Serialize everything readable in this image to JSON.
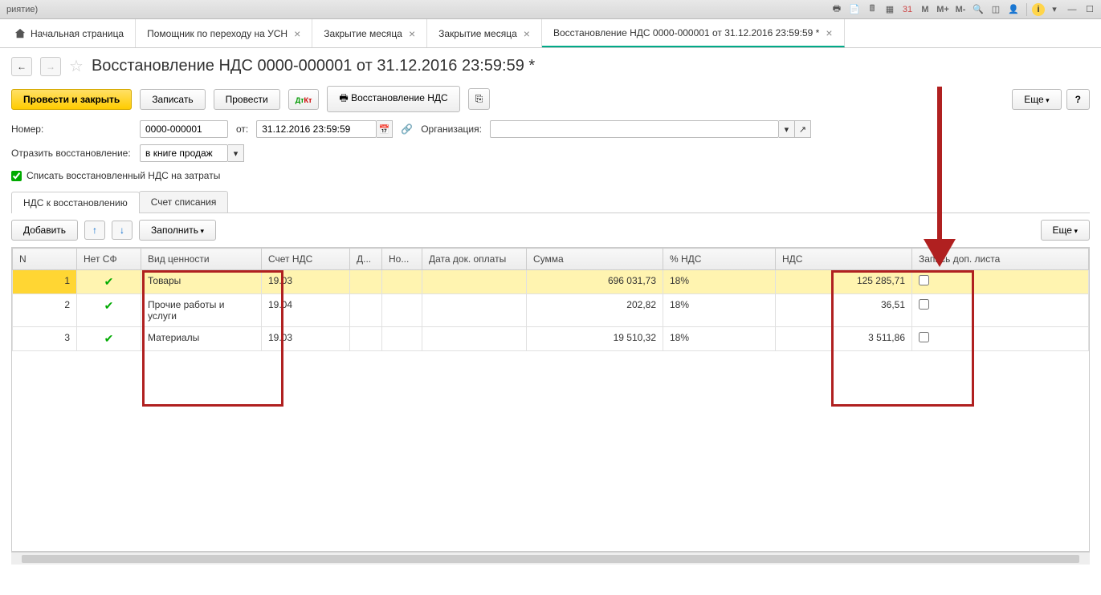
{
  "sys": {
    "title_fragment": "риятие)"
  },
  "tabs": {
    "home": "Начальная страница",
    "items": [
      "Помощник по переходу на УСН",
      "Закрытие месяца",
      "Закрытие месяца",
      "Восстановление НДС 0000-000001 от 31.12.2016 23:59:59 *"
    ],
    "active_index": 3
  },
  "header": {
    "title": "Восстановление НДС 0000-000001 от 31.12.2016 23:59:59 *"
  },
  "toolbar": {
    "submit": "Провести и закрыть",
    "save": "Записать",
    "post": "Провести",
    "dtkt": "Дт Кт",
    "print": "Восстановление НДС",
    "more": "Еще",
    "help": "?"
  },
  "form": {
    "number_label": "Номер:",
    "number_value": "0000-000001",
    "date_label": "от:",
    "date_value": "31.12.2016 23:59:59",
    "org_label": "Организация:",
    "org_value": "",
    "reflect_label": "Отразить восстановление:",
    "reflect_value": "в книге продаж",
    "checkbox_label": "Списать восстановленный НДС на затраты"
  },
  "inner_tabs": {
    "tab1": "НДС к восстановлению",
    "tab2": "Счет списания"
  },
  "table_toolbar": {
    "add": "Добавить",
    "fill": "Заполнить",
    "more": "Еще"
  },
  "columns": {
    "n": "N",
    "no_sf": "Нет СФ",
    "type": "Вид ценности",
    "account": "Счет НДС",
    "d": "Д...",
    "no": "Но...",
    "paydate": "Дата док. оплаты",
    "sum": "Сумма",
    "pct": "% НДС",
    "nds": "НДС",
    "extra": "Запись доп. листа"
  },
  "rows": [
    {
      "n": "1",
      "no_sf": true,
      "type": "Товары",
      "account": "19.03",
      "sum": "696 031,73",
      "pct": "18%",
      "nds": "125 285,71",
      "extra": false
    },
    {
      "n": "2",
      "no_sf": true,
      "type": "Прочие работы и услуги",
      "account": "19.04",
      "sum": "202,82",
      "pct": "18%",
      "nds": "36,51",
      "extra": false
    },
    {
      "n": "3",
      "no_sf": true,
      "type": "Материалы",
      "account": "19.03",
      "sum": "19 510,32",
      "pct": "18%",
      "nds": "3 511,86",
      "extra": false
    }
  ]
}
